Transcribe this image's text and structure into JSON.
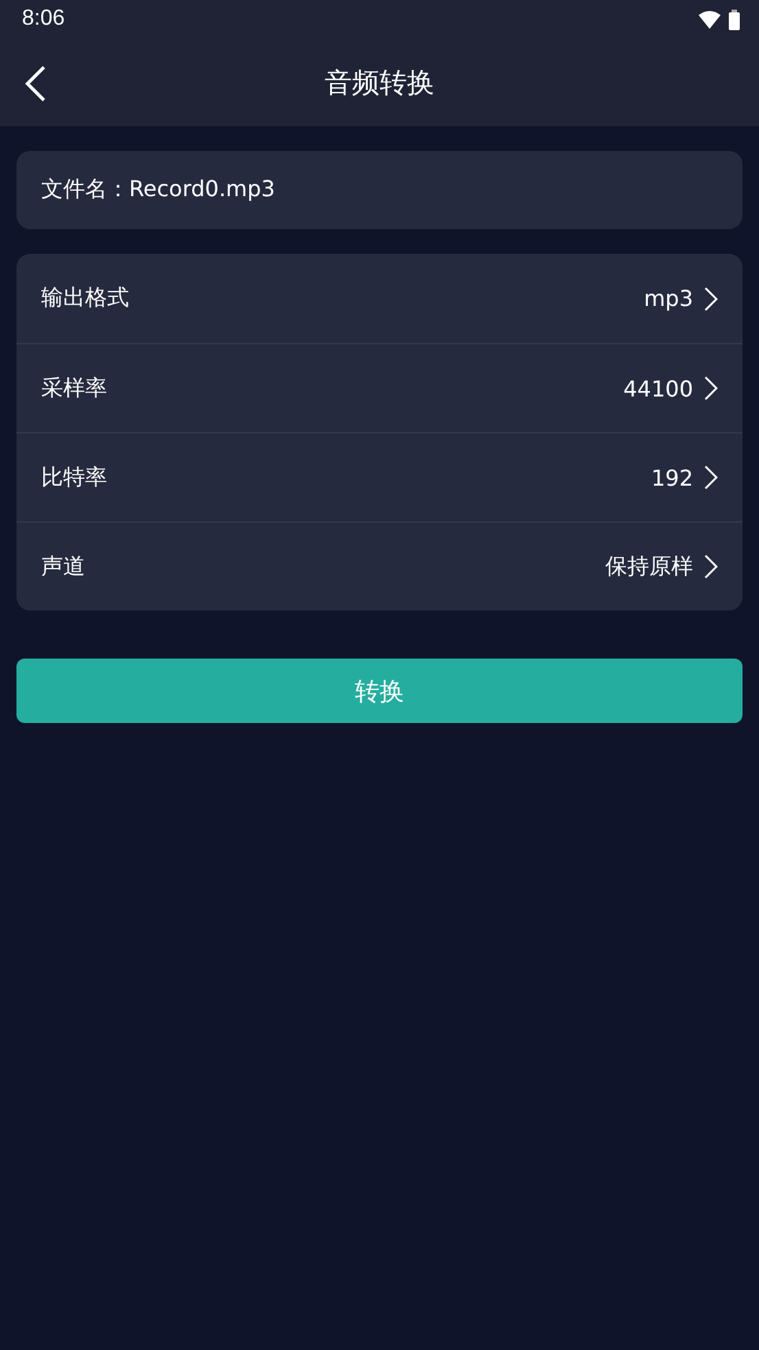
{
  "status_bar": {
    "time": "8:06"
  },
  "header": {
    "title": "音频转换"
  },
  "file": {
    "text": "文件名：Record0.mp3"
  },
  "settings": [
    {
      "label": "输出格式",
      "value": "mp3"
    },
    {
      "label": "采样率",
      "value": "44100"
    },
    {
      "label": "比特率",
      "value": "192"
    },
    {
      "label": "声道",
      "value": "保持原样"
    }
  ],
  "convert_button": {
    "label": "转换"
  }
}
